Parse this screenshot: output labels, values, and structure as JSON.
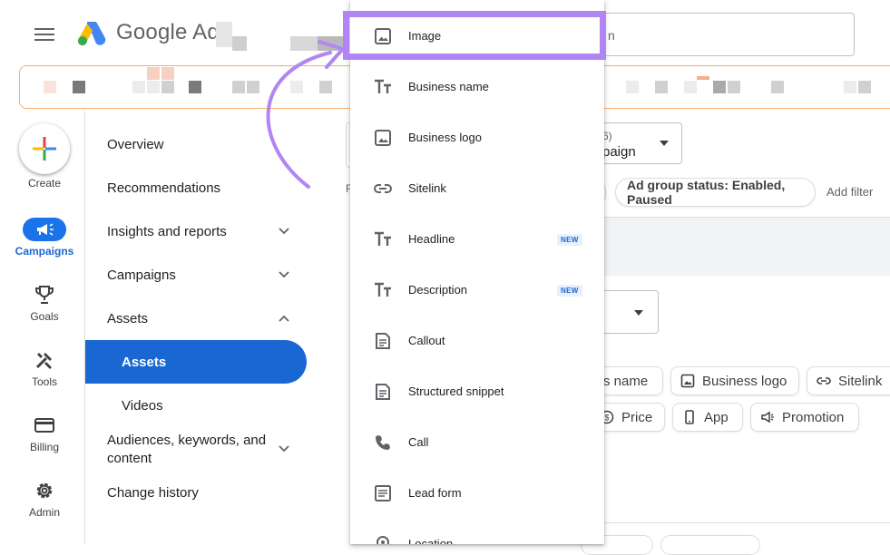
{
  "header": {
    "brand": "Google Ads",
    "search_text": "n"
  },
  "rail": {
    "create": "Create",
    "campaigns": "Campaigns",
    "goals": "Goals",
    "tools": "Tools",
    "billing": "Billing",
    "admin": "Admin"
  },
  "nav": {
    "overview": "Overview",
    "recommendations": "Recommendations",
    "insights": "Insights and reports",
    "campaigns": "Campaigns",
    "assets_group": "Assets",
    "assets": "Assets",
    "videos": "Videos",
    "audiences_line1": "Audiences, keywords, and",
    "audiences_line2": "content",
    "change_history": "Change history"
  },
  "background": {
    "campaign_count": "6)",
    "campaign_label": "paign",
    "filter_r": "F",
    "ad_group_filter": "Ad group status: Enabled, Paused",
    "add_filter": "Add filter",
    "chips_row1": [
      "s name",
      "Business logo",
      "Sitelink"
    ],
    "chips_row2": [
      "Price",
      "App",
      "Promotion"
    ]
  },
  "dropdown": {
    "items": [
      {
        "label": "Image",
        "icon": "image-icon"
      },
      {
        "label": "Business name",
        "icon": "text-icon"
      },
      {
        "label": "Business logo",
        "icon": "image-icon"
      },
      {
        "label": "Sitelink",
        "icon": "link-icon"
      },
      {
        "label": "Headline",
        "icon": "text-icon",
        "badge": "NEW"
      },
      {
        "label": "Description",
        "icon": "text-icon",
        "badge": "NEW"
      },
      {
        "label": "Callout",
        "icon": "document-icon"
      },
      {
        "label": "Structured snippet",
        "icon": "document-icon"
      },
      {
        "label": "Call",
        "icon": "phone-icon"
      },
      {
        "label": "Lead form",
        "icon": "form-icon"
      },
      {
        "label": "Location",
        "icon": "location-icon"
      }
    ]
  },
  "colors": {
    "accent": "#1967d2",
    "highlight": "#b285f5",
    "banner_border": "#f6ad6a"
  }
}
